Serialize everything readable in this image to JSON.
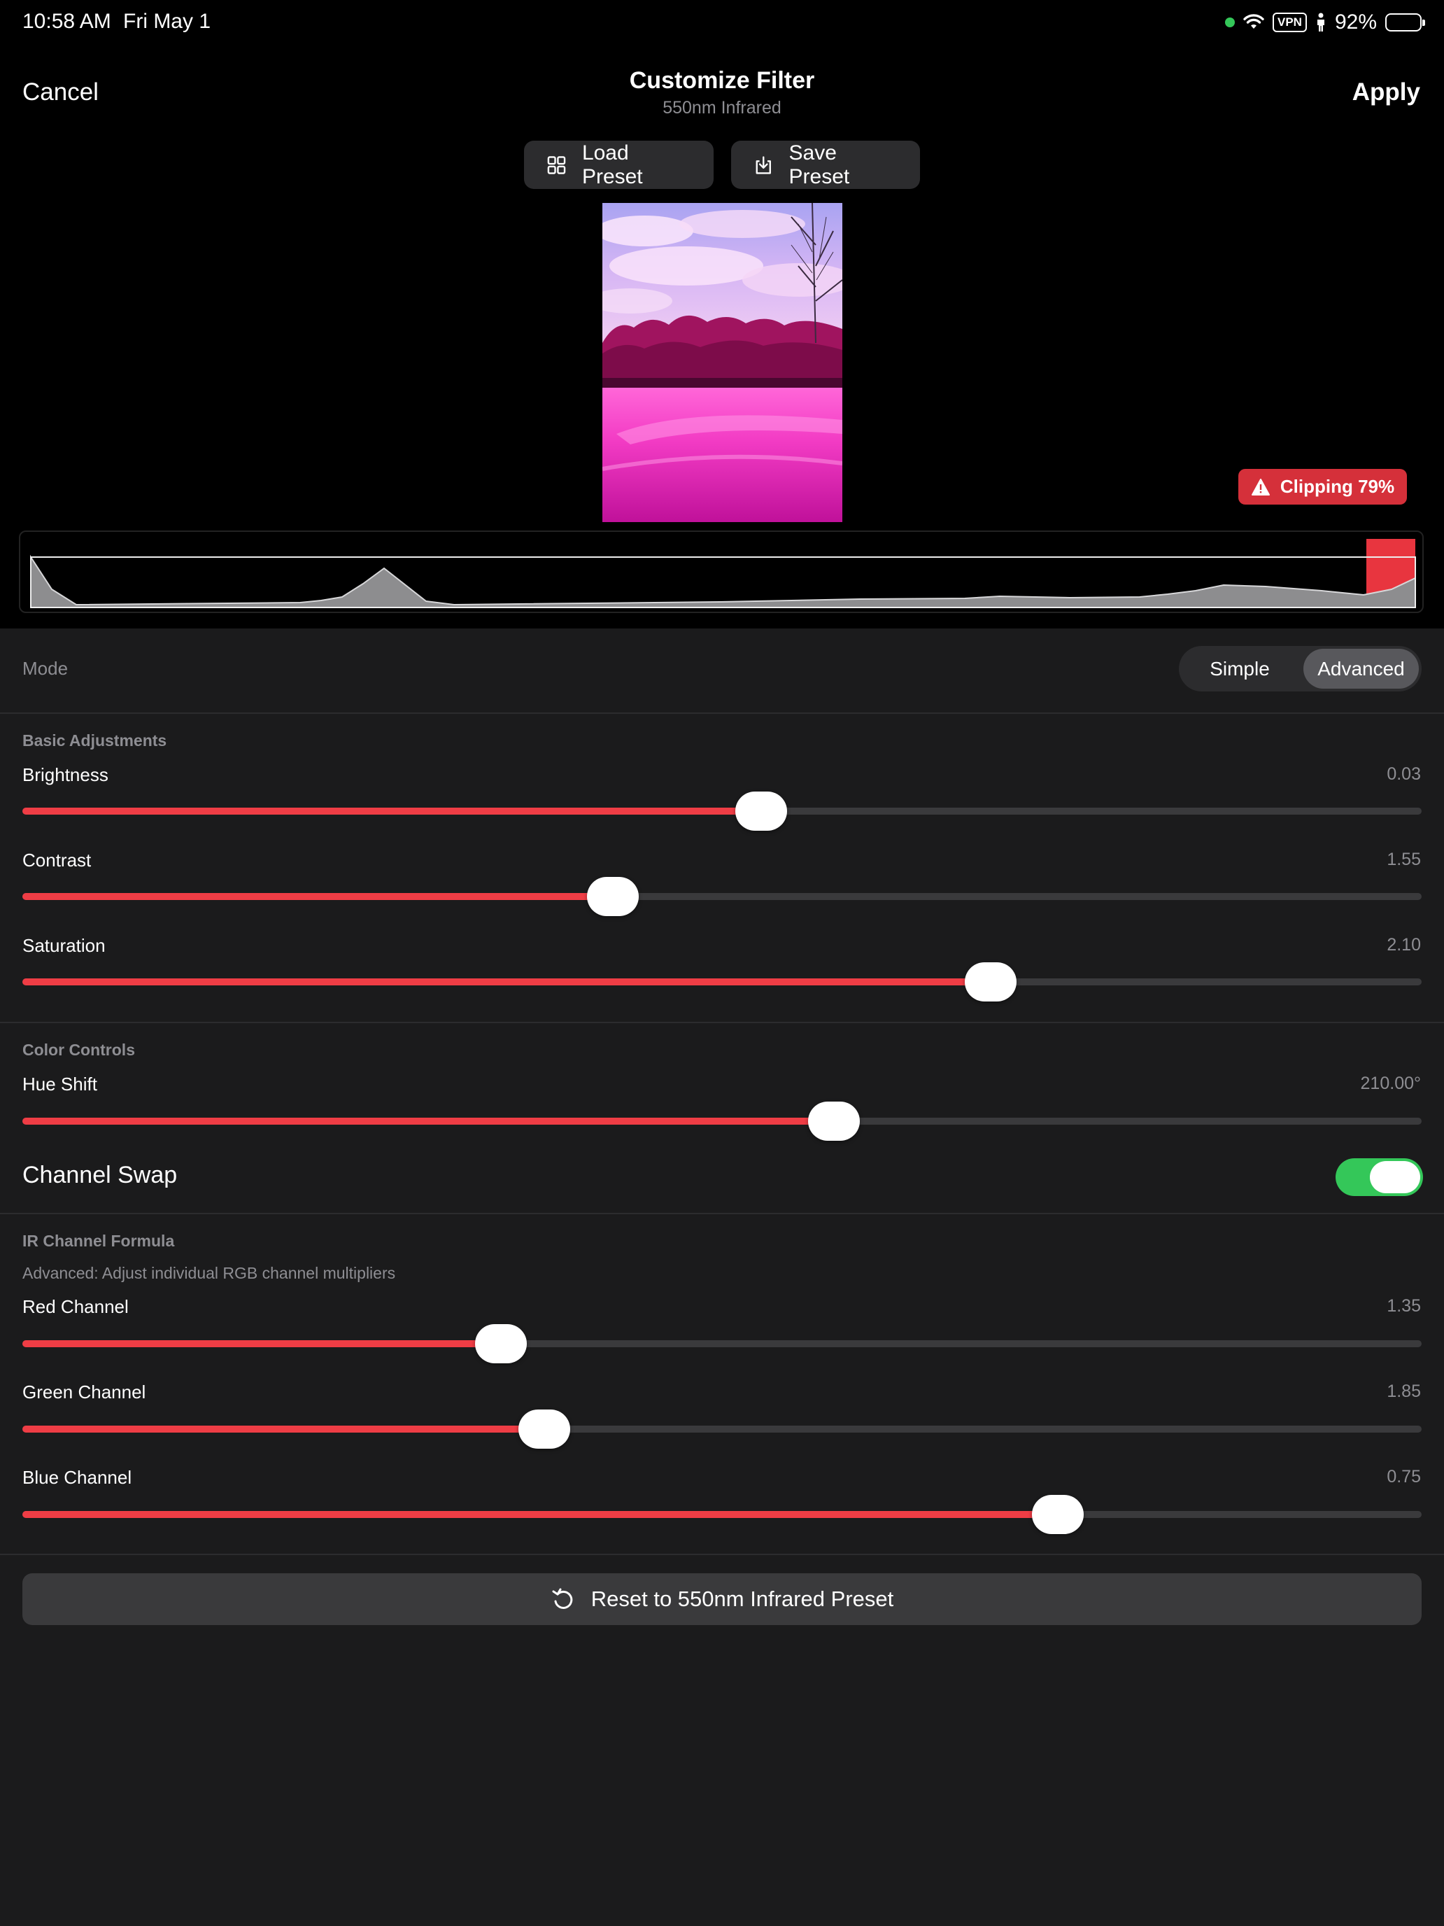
{
  "status_bar": {
    "time": "10:58 AM",
    "date": "Fri May 1",
    "vpn": "VPN",
    "battery": "92%",
    "battery_level": 0.92
  },
  "nav": {
    "cancel": "Cancel",
    "title": "Customize Filter",
    "subtitle": "550nm Infrared",
    "apply": "Apply"
  },
  "presets": {
    "load": "Load Preset",
    "save": "Save Preset"
  },
  "clipping": {
    "label": "Clipping 79%",
    "color": "#d5303a"
  },
  "mode": {
    "label": "Mode",
    "options": [
      "Simple",
      "Advanced"
    ],
    "selected": "Advanced"
  },
  "basic": {
    "section": "Basic Adjustments",
    "brightness": {
      "label": "Brightness",
      "value": "0.03",
      "level": 0.528
    },
    "contrast": {
      "label": "Contrast",
      "value": "1.55",
      "level": 0.422
    },
    "saturation": {
      "label": "Saturation",
      "value": "2.10",
      "level": 0.692
    }
  },
  "color": {
    "section": "Color Controls",
    "hue": {
      "label": "Hue Shift",
      "value": "210.00°",
      "level": 0.58
    }
  },
  "channel_swap": {
    "label": "Channel Swap",
    "on": true
  },
  "ir": {
    "section": "IR Channel Formula",
    "help": "Advanced: Adjust individual RGB channel multipliers",
    "red": {
      "label": "Red Channel",
      "value": "1.35",
      "level": 0.342
    },
    "green": {
      "label": "Green Channel",
      "value": "1.85",
      "level": 0.373
    },
    "blue": {
      "label": "Blue Channel",
      "value": "0.75",
      "level": 0.74
    }
  },
  "reset": {
    "label": "Reset to 550nm Infrared Preset"
  },
  "colors": {
    "accent": "#ef3d45",
    "toggle_on": "#34c759",
    "background": "#1b1b1c"
  }
}
